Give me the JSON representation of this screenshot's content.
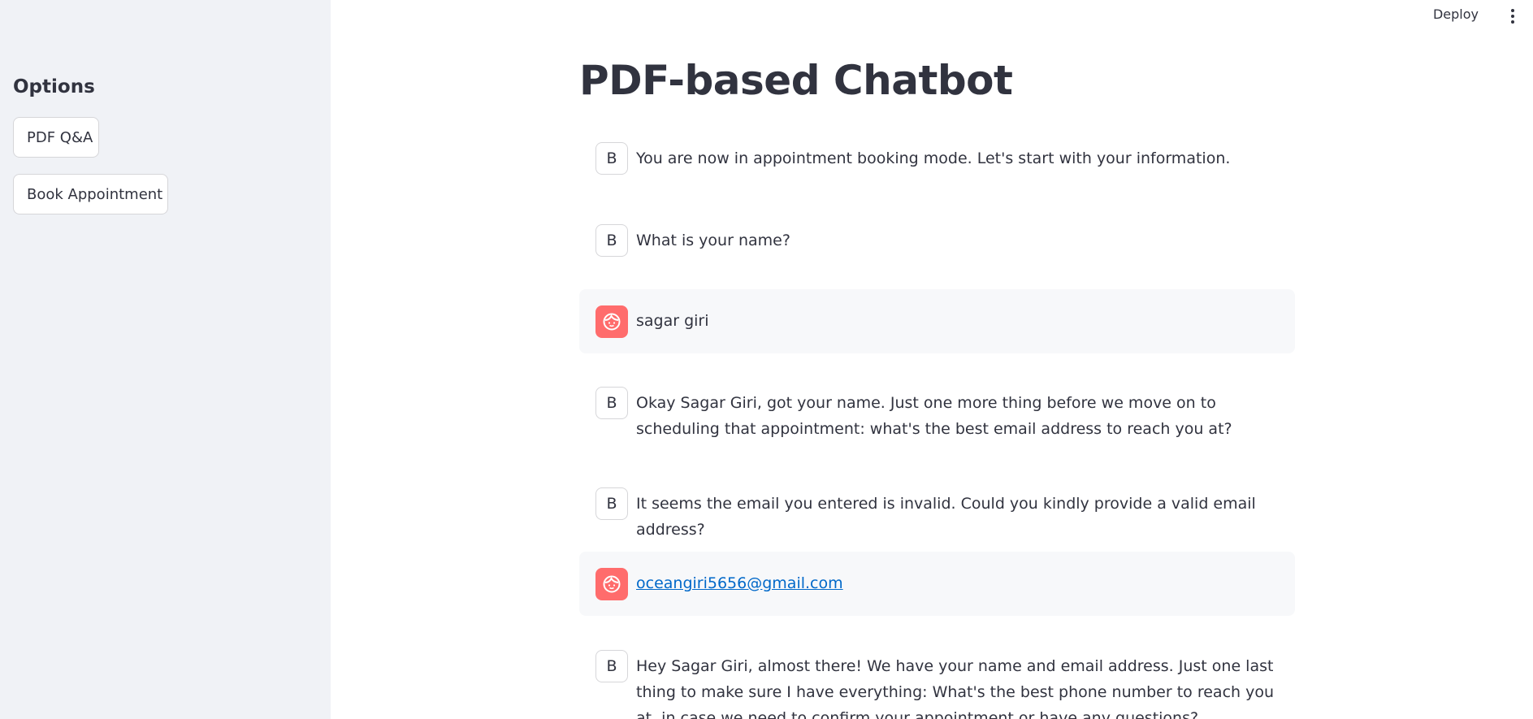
{
  "sidebar": {
    "heading": "Options",
    "buttons": [
      "PDF Q&A",
      "Book Appointment"
    ]
  },
  "header": {
    "deploy_label": "Deploy",
    "menu_icon": "more-vertical-icon"
  },
  "main": {
    "title": "PDF-based Chatbot",
    "messages": [
      {
        "role": "bot",
        "avatar": "B",
        "text": "You are now in appointment booking mode. Let's start with your information."
      },
      {
        "role": "bot",
        "avatar": "B",
        "text": "What is your name?"
      },
      {
        "role": "user",
        "avatar_icon": "user-face-icon",
        "text": "sagar giri"
      },
      {
        "role": "bot",
        "avatar": "B",
        "text": "Okay Sagar Giri, got your name. Just one more thing before we move on to scheduling that appointment: what's the best email address to reach you at?"
      },
      {
        "role": "bot",
        "avatar": "B",
        "text": "It seems the email you entered is invalid. Could you kindly provide a valid email address?"
      },
      {
        "role": "user",
        "avatar_icon": "user-face-icon",
        "text": "oceangiri5656@gmail.com"
      },
      {
        "role": "bot",
        "avatar": "B",
        "text": "Hey Sagar Giri, almost there! We have your name and email address. Just one last thing to make sure I have everything: What's the best phone number to reach you at, in case we need to confirm your appointment or have any questions?"
      }
    ]
  },
  "colors": {
    "sidebar_bg": "#f0f2f6",
    "user_avatar": "#ff6c6c",
    "link": "#0068c9",
    "text": "#31333f"
  }
}
